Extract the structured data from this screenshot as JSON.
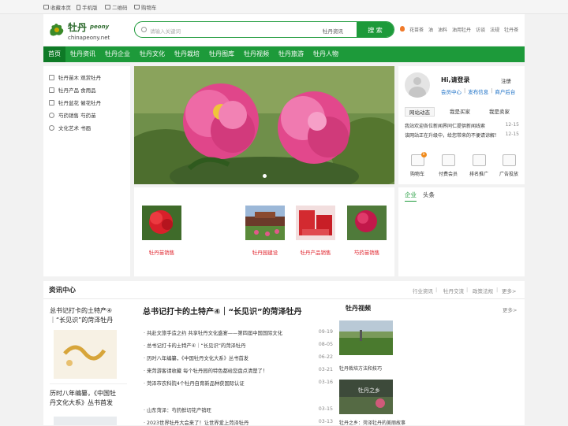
{
  "topbar": {
    "bookmark": "收藏本页",
    "mobile": "手机版",
    "qrcode": "二维码",
    "cart": "购物车"
  },
  "header": {
    "logo_cn": "牡丹",
    "logo_en": "peony",
    "logo_url": "chinapeony.net",
    "search_placeholder": "请输入关键词",
    "search_category": "牡丹资讯",
    "search_button": "搜 索",
    "hot_words": [
      "花苗茶",
      "油",
      "油料",
      "油用牡丹",
      "访谈",
      "法规",
      "牡丹茶"
    ]
  },
  "nav": [
    "首页",
    "牡丹资讯",
    "牡丹企业",
    "牡丹文化",
    "牡丹栽培",
    "牡丹图库",
    "牡丹视频",
    "牡丹旅游",
    "牡丹人物"
  ],
  "categories": [
    "牡丹苗木 观赏牡丹",
    "牡丹产品 食用品",
    "牡丹盆花 催花牡丹",
    "芍药销售 芍药苗",
    "文化艺术 书画"
  ],
  "user": {
    "greeting": "Hi,请登录",
    "register": "注册",
    "links": [
      "会员中心",
      "发布信息",
      "商户后台"
    ],
    "tabs": [
      "网站动态",
      "我是买家",
      "我是卖家"
    ],
    "notices": [
      {
        "text": "我站欢迎各位新闻界同仁提供新闻线索",
        "date": "12-15"
      },
      {
        "text": "该网站正在升级中，给您带来的不便请谅解！",
        "date": "12-15"
      }
    ],
    "services": [
      "购物车",
      "付费会员",
      "排名推广",
      "广告投放"
    ],
    "cart_badge": "0"
  },
  "products": [
    "牡丹苗销售",
    "牡丹园建设",
    "牡丹产品销售",
    "芍药苗销售"
  ],
  "enterprise_tabs": [
    "企业",
    "头条"
  ],
  "news": {
    "title": "资讯中心",
    "more_links": [
      "行业资讯",
      "牡丹交流",
      "政策法规",
      "更多>"
    ],
    "left_cards": [
      {
        "title": "总书记打卡的土特产④｜“长见识”的菏泽牡丹"
      },
      {
        "title": "历时八年编纂，《中国牡丹文化大系》丛书首发"
      }
    ],
    "headline": "总书记打卡的土特产④｜“长见识”的菏泽牡丹",
    "list": [
      {
        "text": "· 共赴文旅手造之约 共享牡丹文化盛宴——第四届中国国际文化",
        "date": "09-19"
      },
      {
        "text": "· 总书记打卡的土特产④｜“长见识”的菏泽牡丹",
        "date": "08-05"
      },
      {
        "text": "· 历时八年编纂，《中国牡丹文化大系》丛书首发",
        "date": "06-22"
      },
      {
        "text": "· 来菏游客请收藏 每个牡丹园的特色都给您盘点清楚了！",
        "date": "03-21"
      },
      {
        "text": "· 菏泽市农科院4个牡丹自育新品种获国际认证",
        "date": "03-16"
      },
      {
        "text": "· 山东菏泽：芍药鲜切花产销旺",
        "date": "03-15"
      },
      {
        "text": "· 2023世界牡丹大会来了！让世界爱上菏泽牡丹",
        "date": "03-13"
      }
    ],
    "video_title": "牡丹视频",
    "video_more": "更多>",
    "videos": [
      "牡丹栽培方法和技巧",
      "牡丹之乡：菏泽牡丹的美丽故事"
    ]
  }
}
